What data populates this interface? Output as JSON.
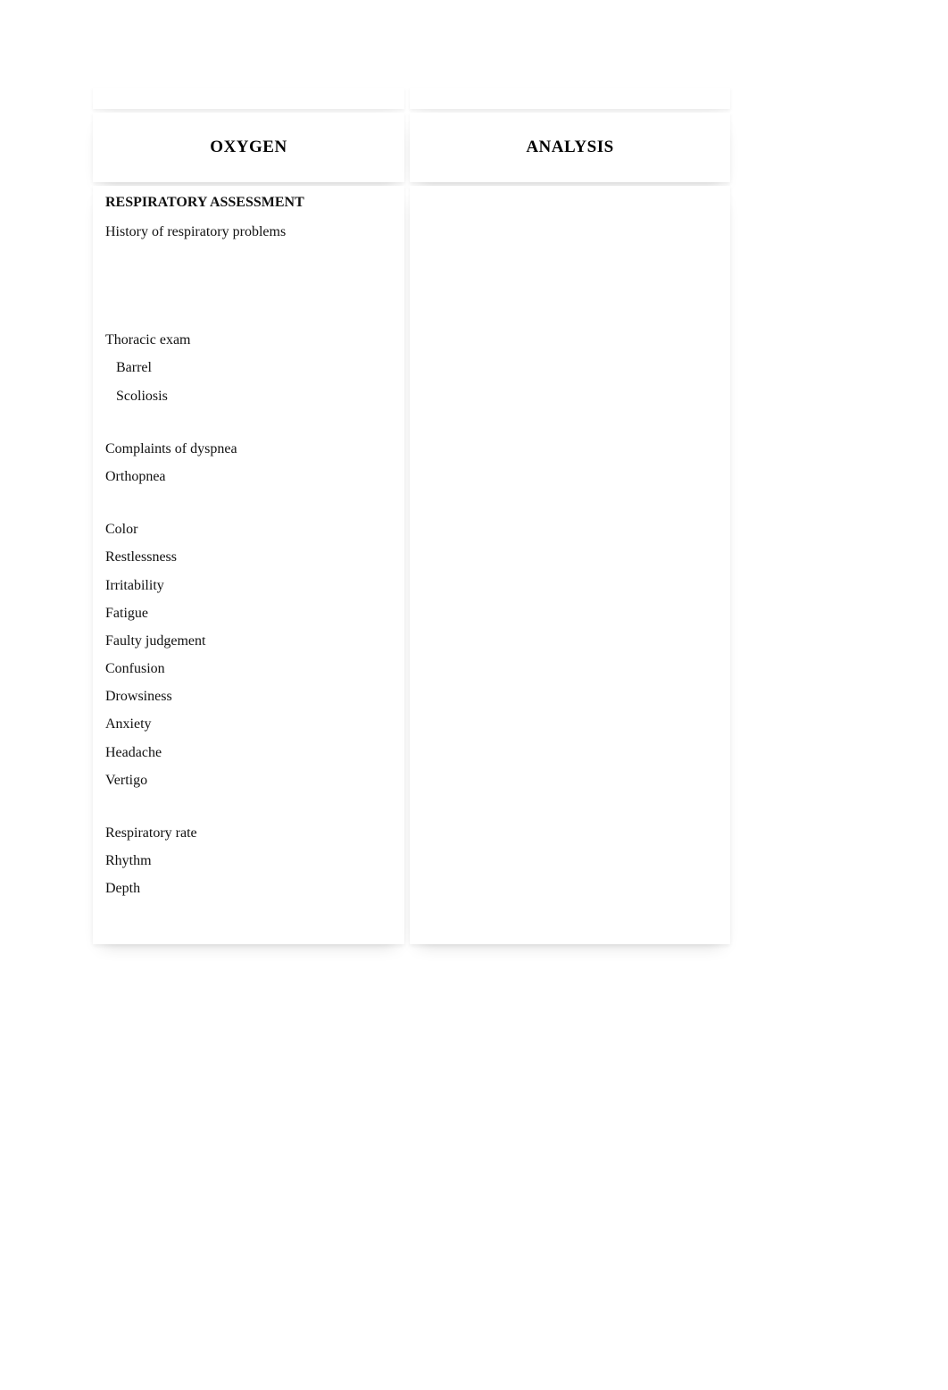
{
  "columns": {
    "left_title": "OXYGEN",
    "right_title": "ANALYSIS"
  },
  "section_heading": "RESPIRATORY ASSESSMENT",
  "groups": [
    {
      "items": [
        {
          "text": "History of respiratory problems",
          "indent": false
        }
      ],
      "spacer_after": "lg"
    },
    {
      "items": [
        {
          "text": "Thoracic exam",
          "indent": false
        },
        {
          "text": "Barrel",
          "indent": true
        },
        {
          "text": "Scoliosis",
          "indent": true
        }
      ],
      "spacer_after": "md"
    },
    {
      "items": [
        {
          "text": "Complaints of dyspnea",
          "indent": false
        },
        {
          "text": "Orthopnea",
          "indent": false
        }
      ],
      "spacer_after": "md"
    },
    {
      "items": [
        {
          "text": "Color",
          "indent": false
        },
        {
          "text": "Restlessness",
          "indent": false
        },
        {
          "text": "Irritability",
          "indent": false
        },
        {
          "text": "Fatigue",
          "indent": false
        },
        {
          "text": "Faulty judgement",
          "indent": false
        },
        {
          "text": "Confusion",
          "indent": false
        },
        {
          "text": "Drowsiness",
          "indent": false
        },
        {
          "text": "Anxiety",
          "indent": false
        },
        {
          "text": "Headache",
          "indent": false
        },
        {
          "text": "Vertigo",
          "indent": false
        }
      ],
      "spacer_after": "md"
    },
    {
      "items": [
        {
          "text": "Respiratory rate",
          "indent": false
        },
        {
          "text": "Rhythm",
          "indent": false
        },
        {
          "text": "Depth",
          "indent": false
        }
      ],
      "spacer_after": null
    }
  ]
}
